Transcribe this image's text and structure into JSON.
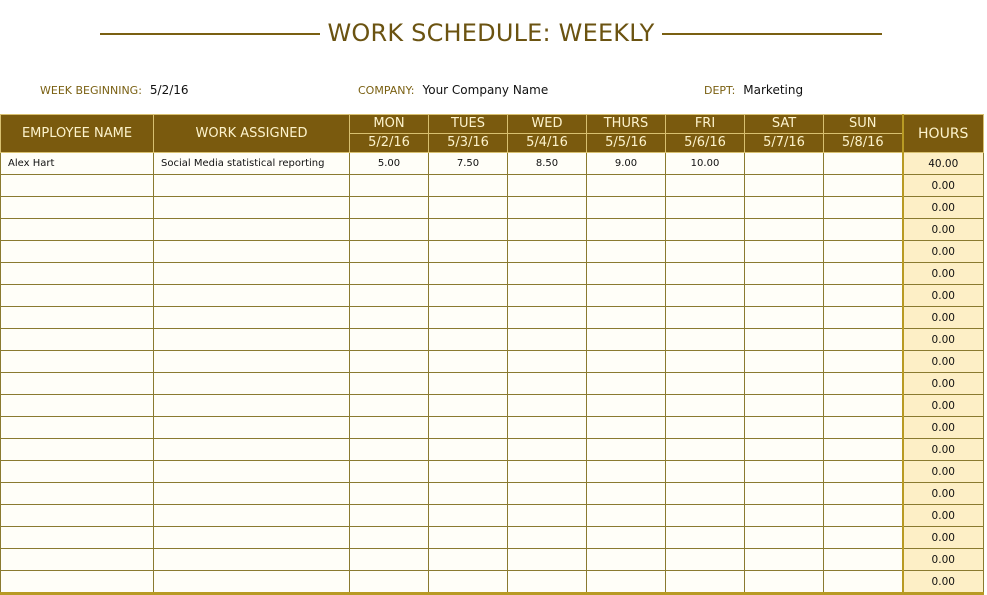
{
  "title": "WORK SCHEDULE: WEEKLY",
  "meta": {
    "week_label": "WEEK BEGINNING:",
    "week_value": "5/2/16",
    "company_label": "COMPANY:",
    "company_value": "Your Company Name",
    "dept_label": "DEPT:",
    "dept_value": "Marketing"
  },
  "table": {
    "headers": {
      "employee": "EMPLOYEE NAME",
      "work": "WORK ASSIGNED",
      "hours": "HOURS"
    },
    "days": [
      {
        "day": "MON",
        "date": "5/2/16"
      },
      {
        "day": "TUES",
        "date": "5/3/16"
      },
      {
        "day": "WED",
        "date": "5/4/16"
      },
      {
        "day": "THURS",
        "date": "5/5/16"
      },
      {
        "day": "FRI",
        "date": "5/6/16"
      },
      {
        "day": "SAT",
        "date": "5/7/16"
      },
      {
        "day": "SUN",
        "date": "5/8/16"
      }
    ],
    "rows": [
      {
        "employee": "Alex Hart",
        "work": "Social Media statistical reporting",
        "hours_by_day": [
          "5.00",
          "7.50",
          "8.50",
          "9.00",
          "10.00",
          "",
          ""
        ],
        "total": "40.00"
      },
      {
        "employee": "",
        "work": "",
        "hours_by_day": [
          "",
          "",
          "",
          "",
          "",
          "",
          ""
        ],
        "total": "0.00"
      },
      {
        "employee": "",
        "work": "",
        "hours_by_day": [
          "",
          "",
          "",
          "",
          "",
          "",
          ""
        ],
        "total": "0.00"
      },
      {
        "employee": "",
        "work": "",
        "hours_by_day": [
          "",
          "",
          "",
          "",
          "",
          "",
          ""
        ],
        "total": "0.00"
      },
      {
        "employee": "",
        "work": "",
        "hours_by_day": [
          "",
          "",
          "",
          "",
          "",
          "",
          ""
        ],
        "total": "0.00"
      },
      {
        "employee": "",
        "work": "",
        "hours_by_day": [
          "",
          "",
          "",
          "",
          "",
          "",
          ""
        ],
        "total": "0.00"
      },
      {
        "employee": "",
        "work": "",
        "hours_by_day": [
          "",
          "",
          "",
          "",
          "",
          "",
          ""
        ],
        "total": "0.00"
      },
      {
        "employee": "",
        "work": "",
        "hours_by_day": [
          "",
          "",
          "",
          "",
          "",
          "",
          ""
        ],
        "total": "0.00"
      },
      {
        "employee": "",
        "work": "",
        "hours_by_day": [
          "",
          "",
          "",
          "",
          "",
          "",
          ""
        ],
        "total": "0.00"
      },
      {
        "employee": "",
        "work": "",
        "hours_by_day": [
          "",
          "",
          "",
          "",
          "",
          "",
          ""
        ],
        "total": "0.00"
      },
      {
        "employee": "",
        "work": "",
        "hours_by_day": [
          "",
          "",
          "",
          "",
          "",
          "",
          ""
        ],
        "total": "0.00"
      },
      {
        "employee": "",
        "work": "",
        "hours_by_day": [
          "",
          "",
          "",
          "",
          "",
          "",
          ""
        ],
        "total": "0.00"
      },
      {
        "employee": "",
        "work": "",
        "hours_by_day": [
          "",
          "",
          "",
          "",
          "",
          "",
          ""
        ],
        "total": "0.00"
      },
      {
        "employee": "",
        "work": "",
        "hours_by_day": [
          "",
          "",
          "",
          "",
          "",
          "",
          ""
        ],
        "total": "0.00"
      },
      {
        "employee": "",
        "work": "",
        "hours_by_day": [
          "",
          "",
          "",
          "",
          "",
          "",
          ""
        ],
        "total": "0.00"
      },
      {
        "employee": "",
        "work": "",
        "hours_by_day": [
          "",
          "",
          "",
          "",
          "",
          "",
          ""
        ],
        "total": "0.00"
      },
      {
        "employee": "",
        "work": "",
        "hours_by_day": [
          "",
          "",
          "",
          "",
          "",
          "",
          ""
        ],
        "total": "0.00"
      },
      {
        "employee": "",
        "work": "",
        "hours_by_day": [
          "",
          "",
          "",
          "",
          "",
          "",
          ""
        ],
        "total": "0.00"
      },
      {
        "employee": "",
        "work": "",
        "hours_by_day": [
          "",
          "",
          "",
          "",
          "",
          "",
          ""
        ],
        "total": "0.00"
      },
      {
        "employee": "",
        "work": "",
        "hours_by_day": [
          "",
          "",
          "",
          "",
          "",
          "",
          ""
        ],
        "total": "0.00"
      }
    ]
  }
}
